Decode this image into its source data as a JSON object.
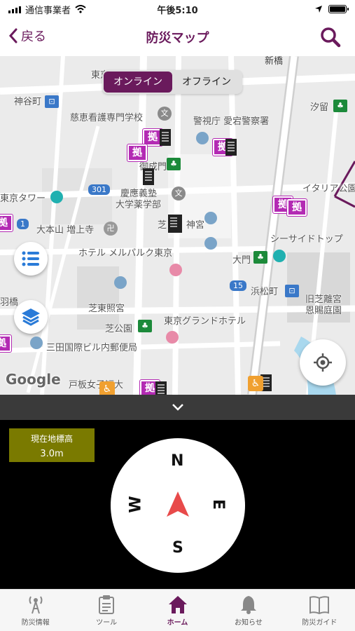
{
  "status": {
    "carrier": "通信事業者",
    "time": "午後5:10"
  },
  "nav": {
    "back_label": "戻る",
    "title": "防災マップ"
  },
  "map": {
    "segment": {
      "online": "オンライン",
      "offline": "オフライン"
    },
    "labels": {
      "shinbashi": "新橋",
      "higashi": "東京",
      "kamiyacho": "神谷町",
      "jikei": "慈恵看護専門学校",
      "keishicho": "警視庁 愛宕警察署",
      "shiodome": "汐留",
      "onarimon": "御成門",
      "keio": "慶應義塾",
      "keio2": "大学薬学部",
      "italy": "イタリア公園",
      "tower": "東京タワー",
      "route301": "301",
      "zojoji": "大本山 増上寺",
      "shiba": "芝",
      "shibajinja": "神宮",
      "seaside": "シーサイドトップ",
      "hotel": "ホテル メルパルク東京",
      "daimon": "大門",
      "route15": "15",
      "hamamatsucho": "浜松町",
      "kyushiba": "旧芝離宮",
      "kyushiba2": "恩賜庭園",
      "hashi": "羽橋",
      "shibatoshogu": "芝東照宮",
      "shibakoen": "芝公園",
      "grandhotel": "東京グランドホテル",
      "mita": "三田国際ビル内郵便局",
      "toita": "戸板女子短大",
      "google": "Google",
      "kyoten_char": "拠"
    }
  },
  "elevation": {
    "title": "現在地標高",
    "value": "3.0m"
  },
  "compass": {
    "n": "N",
    "e": "E",
    "s": "S",
    "w": "W"
  },
  "tabs": [
    {
      "label": "防災情報",
      "icon": "antenna-icon"
    },
    {
      "label": "ツール",
      "icon": "clipboard-icon"
    },
    {
      "label": "ホーム",
      "icon": "home-icon"
    },
    {
      "label": "お知らせ",
      "icon": "bell-icon"
    },
    {
      "label": "防災ガイド",
      "icon": "book-icon"
    }
  ],
  "colors": {
    "brand": "#6a1a5c",
    "kyoten": "#b32ab3",
    "elevation_box": "#7a7a00",
    "compass_arrow": "#e84a4a"
  }
}
